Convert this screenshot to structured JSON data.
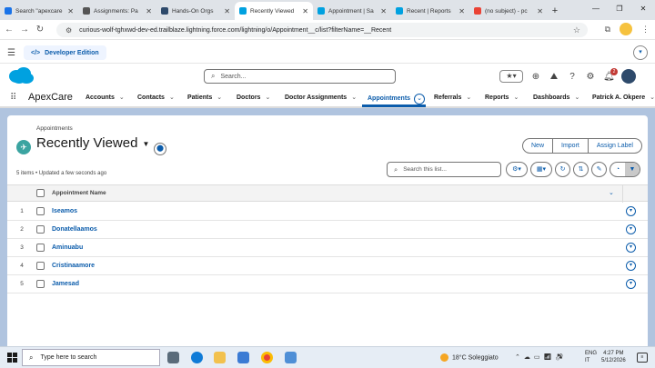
{
  "browser": {
    "tabs": [
      {
        "label": "Search \"apexcare",
        "color": "#1a73e8",
        "active": false
      },
      {
        "label": "Assignments: Pa",
        "color": "#555555",
        "active": false
      },
      {
        "label": "Hands-On Orgs",
        "color": "#2e4a6b",
        "active": false
      },
      {
        "label": "Recently Viewed",
        "color": "#00a1e0",
        "active": true
      },
      {
        "label": "Appointment | Sa",
        "color": "#00a1e0",
        "active": false
      },
      {
        "label": "Recent | Reports",
        "color": "#00a1e0",
        "active": false
      },
      {
        "label": "(no subject) - pc",
        "color": "#ea4335",
        "active": false
      }
    ],
    "new_tab": "+",
    "url": "curious-wolf-tghxwd-dev-ed.trailblaze.lightning.force.com/lightning/o/Appointment__c/list?filterName=__Recent"
  },
  "devbar": {
    "label": "Developer Edition",
    "code_glyph": "</>"
  },
  "header": {
    "search_placeholder": "Search...",
    "notification_count": "2"
  },
  "appnav": {
    "app_name": "ApexCare",
    "items": [
      {
        "label": "Accounts"
      },
      {
        "label": "Contacts"
      },
      {
        "label": "Patients"
      },
      {
        "label": "Doctors"
      },
      {
        "label": "Doctor Assignments"
      },
      {
        "label": "Appointments"
      },
      {
        "label": "Referrals"
      },
      {
        "label": "Reports"
      },
      {
        "label": "Dashboards"
      },
      {
        "label": "Patrick A. Okpere"
      }
    ]
  },
  "list": {
    "breadcrumb": "Appointments",
    "title": "Recently Viewed",
    "meta": "5 items • Updated a few seconds ago",
    "buttons": {
      "new": "New",
      "import": "Import",
      "assign_label": "Assign Label"
    },
    "search_placeholder": "Search this list...",
    "column_header": "Appointment Name",
    "rows": [
      {
        "num": "1",
        "name": "Iseamos"
      },
      {
        "num": "2",
        "name": "Donatellaamos"
      },
      {
        "num": "3",
        "name": "Aminuabu"
      },
      {
        "num": "4",
        "name": "Cristinaamore"
      },
      {
        "num": "5",
        "name": "Jamesad"
      }
    ]
  },
  "taskbar": {
    "search_placeholder": "Type here to search",
    "weather": "18°C  Soleggiato",
    "lang_1": "ENG",
    "lang_2": "IT",
    "time": "4:27 PM",
    "date": "5/12/2026"
  },
  "colors": {
    "brand": "#0b5cab",
    "page_bg": "#b0c4df",
    "list_icon": "#3ba4a1"
  }
}
